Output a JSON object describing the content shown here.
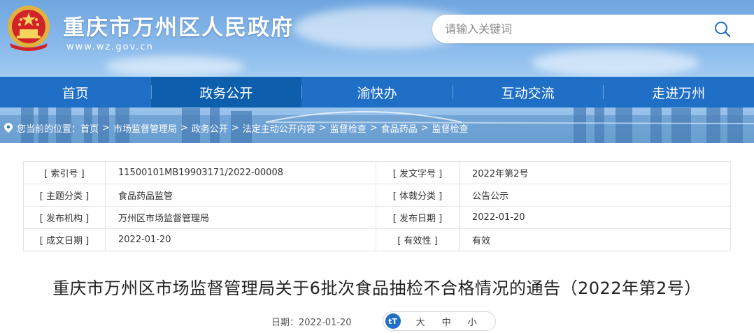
{
  "header": {
    "site_title": "重庆市万州区人民政府",
    "site_url": "www.wz.gov.cn",
    "search_placeholder": "请输入关键词"
  },
  "nav": {
    "items": [
      {
        "label": "首页"
      },
      {
        "label": "政务公开",
        "active": true
      },
      {
        "label": "渝快办"
      },
      {
        "label": "互动交流"
      },
      {
        "label": "走进万州"
      }
    ]
  },
  "breadcrumb": {
    "prefix": "您当前的位置：",
    "separator": ">",
    "items": [
      "首页",
      "市场监督管理局",
      "政务公开",
      "法定主动公开内容",
      "监督检查",
      "食品药品",
      "监督检查"
    ]
  },
  "meta": {
    "rows": [
      {
        "k1": "[ 索引号 ]",
        "v1": "11500101MB19903171/2022-00008",
        "k2": "[ 发文字号 ]",
        "v2": "2022年第2号"
      },
      {
        "k1": "[ 主题分类 ]",
        "v1": "食品药品监管",
        "k2": "[ 体裁分类 ]",
        "v2": "公告公示"
      },
      {
        "k1": "[ 发布机构 ]",
        "v1": "万州区市场监督管理局",
        "k2": "[ 发布日期 ]",
        "v2": "2022-01-20"
      },
      {
        "k1": "[ 成文日期 ]",
        "v1": "2022-01-20",
        "k2": "[ 有效性 ]",
        "v2": "有效"
      }
    ]
  },
  "article": {
    "title": "重庆市万州区市场监督管理局关于6批次食品抽检不合格情况的通告（2022年第2号）",
    "date_label": "日期：2022-01-20",
    "font_icon": "tT",
    "font_sizes": [
      "大",
      "中",
      "小"
    ]
  },
  "colors": {
    "nav_bg": "#1f6fc6",
    "nav_active": "#0d5fae",
    "accent": "#1f6fc6"
  }
}
